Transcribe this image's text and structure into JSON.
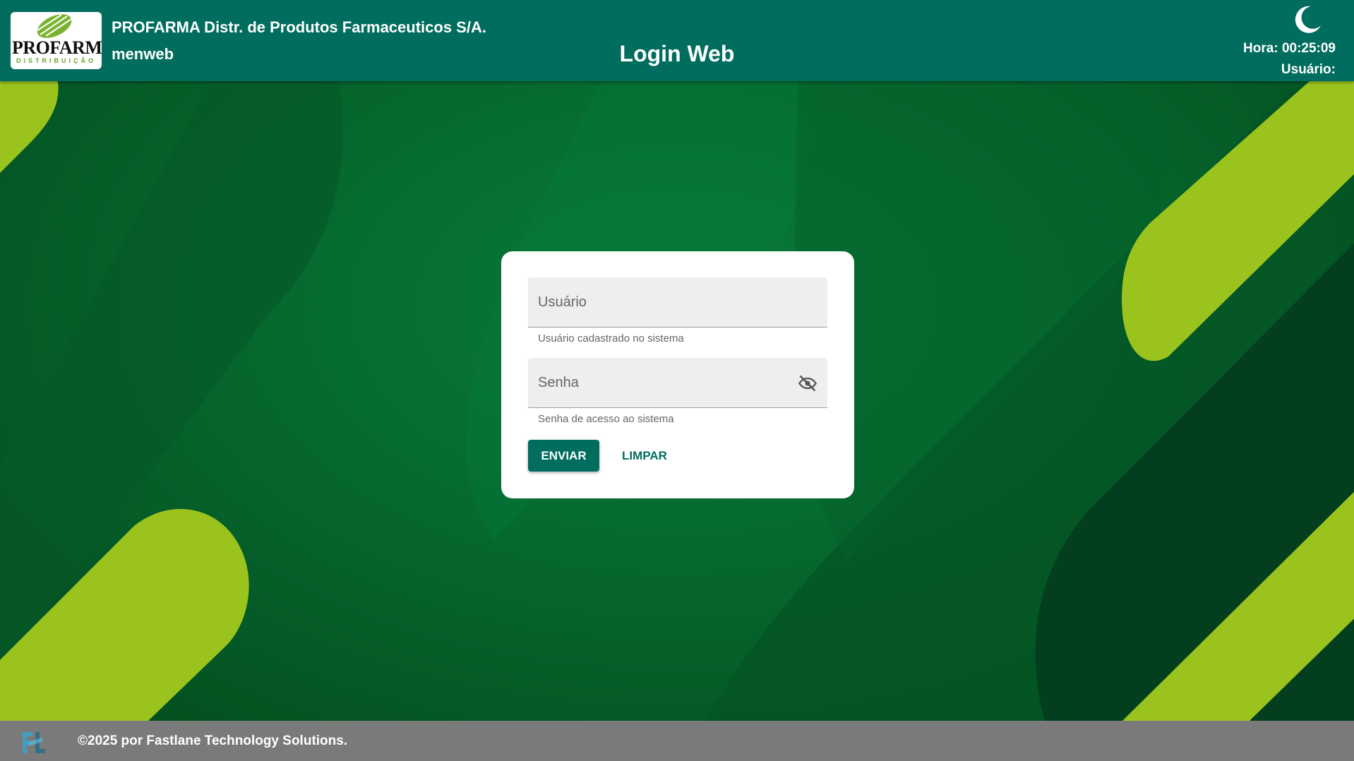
{
  "header": {
    "logo_text": "PROFARMA",
    "logo_subtext": "DISTRIBUIÇÃO",
    "company": "PROFARMA Distr. de Produtos Farmaceuticos S/A.",
    "system": "menweb",
    "title": "Login Web",
    "clock": "Hora: 00:25:09",
    "user": "Usuário:",
    "theme_icon": "moon-icon"
  },
  "login": {
    "user_placeholder": "Usuário",
    "user_value": "",
    "user_hint": "Usuário cadastrado no sistema",
    "password_placeholder": "Senha",
    "password_value": "",
    "password_hint": "Senha de acesso ao sistema",
    "password_toggle_icon": "eye-off-icon",
    "send_label": "ENVIAR",
    "clear_label": "LIMPAR"
  },
  "footer": {
    "copyright": "©2025 por Fastlane Technology Solutions.",
    "logo_icon": "fastlane-logo-icon"
  },
  "colors": {
    "primary": "#006d5e",
    "accent_green": "#9bc31e",
    "background_dark": "#034a1c",
    "footer": "#7a7a7a"
  }
}
